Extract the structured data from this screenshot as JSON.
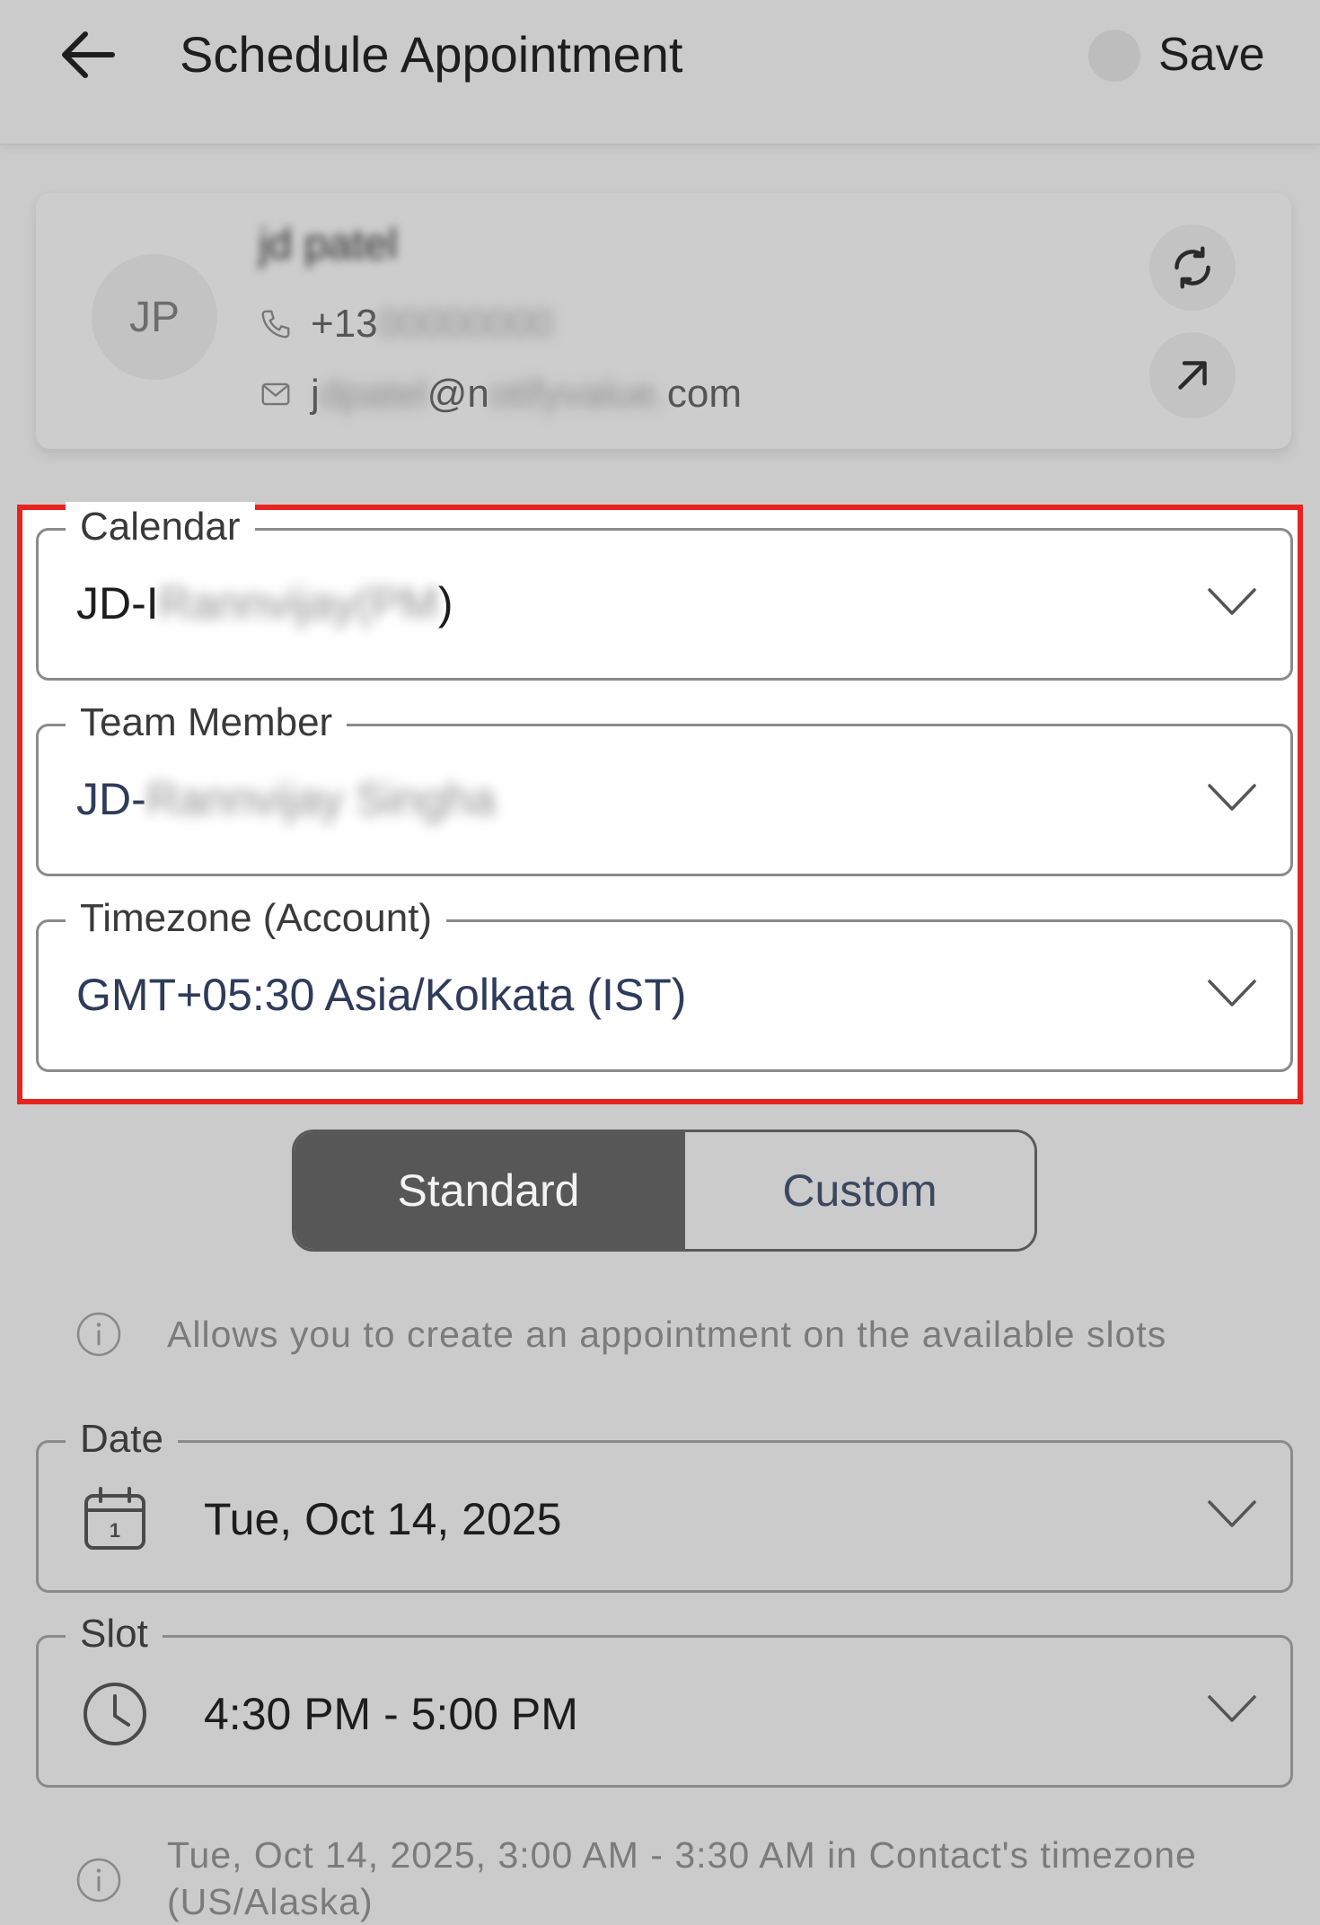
{
  "header": {
    "title": "Schedule Appointment",
    "save_label": "Save"
  },
  "contact": {
    "initials": "JP",
    "name": "jd patel",
    "phone_prefix": "+13",
    "phone_hidden": "00000000",
    "email_start": "j",
    "email_hidden_1": "dpatel",
    "email_middle": "@n",
    "email_hidden_2": "otifyvalue.",
    "email_end": "com"
  },
  "fields": {
    "calendar": {
      "label": "Calendar",
      "value_prefix": "JD-I",
      "value_hidden": "Rannvijay(PM",
      "value_suffix": ")"
    },
    "team_member": {
      "label": "Team Member",
      "value_prefix": "JD-",
      "value_hidden": "Rannvijay Singha"
    },
    "timezone": {
      "label": "Timezone (Account)",
      "value": "GMT+05:30 Asia/Kolkata (IST)"
    },
    "date": {
      "label": "Date",
      "value": "Tue, Oct 14, 2025",
      "icon": "calendar-icon"
    },
    "slot": {
      "label": "Slot",
      "value": "4:30 PM - 5:00 PM",
      "icon": "clock-icon"
    }
  },
  "mode_toggle": {
    "standard_label": "Standard",
    "custom_label": "Custom",
    "selected": "Standard"
  },
  "info": {
    "standard_text": "Allows you to create an appointment on the available slots",
    "contact_timezone_text": "Tue, Oct 14, 2025, 3:00 AM - 3:30 AM in Contact's timezone (US/Alaska)"
  },
  "colors": {
    "highlight": "#e8231f",
    "toggle_selected": "#575757",
    "background": "#cbcbcb"
  }
}
